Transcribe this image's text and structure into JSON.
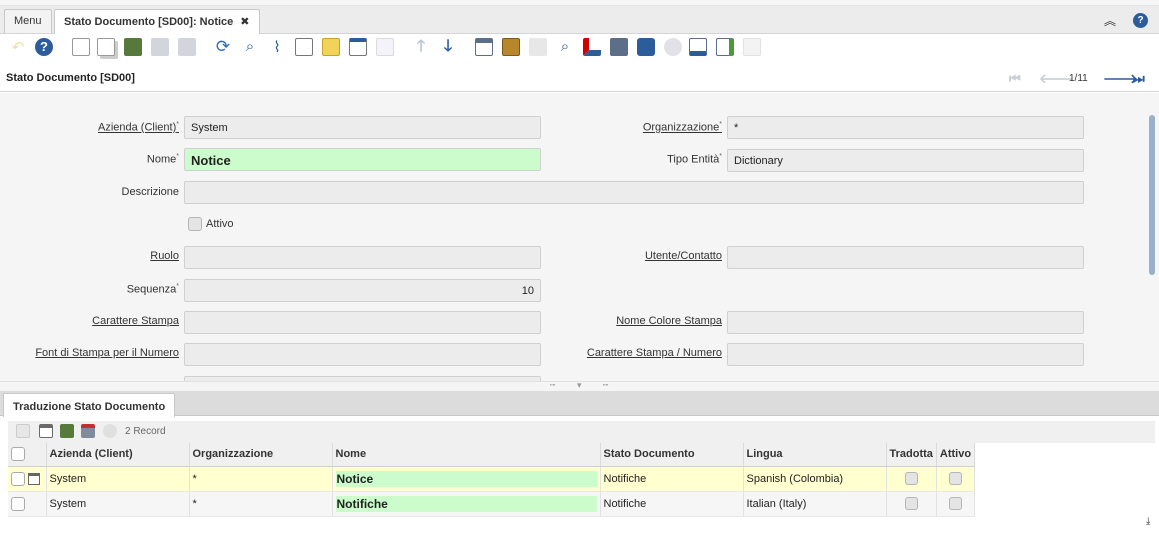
{
  "tabs": [
    {
      "label": "Menu"
    },
    {
      "label": "Stato Documento [SD00]: Notice"
    }
  ],
  "window": {
    "title": "Stato Documento [SD00]",
    "record_position": "1/11"
  },
  "form": {
    "client_label": "Azienda (Client)",
    "client_value": "System",
    "org_label": "Organizzazione",
    "org_value": "*",
    "name_label": "Nome",
    "name_value": "Notice",
    "entity_label": "Tipo Entità",
    "entity_value": "Dictionary",
    "desc_label": "Descrizione",
    "desc_value": "",
    "active_label": "Attivo",
    "role_label": "Ruolo",
    "role_value": "",
    "user_label": "Utente/Contatto",
    "user_value": "",
    "seq_label": "Sequenza",
    "seq_value": "10",
    "print_char_label": "Carattere Stampa",
    "print_char_value": "",
    "print_color_label": "Nome Colore Stampa",
    "print_color_value": "",
    "print_font_label": "Font di Stampa per il Numero",
    "print_font_value": "",
    "print_char_num_label": "Carattere Stampa / Numero",
    "print_char_num_value": ""
  },
  "detail": {
    "tab_label": "Traduzione Stato Documento",
    "record_count": "2 Record",
    "columns": [
      "Azienda (Client)",
      "Organizzazione",
      "Nome",
      "Stato Documento",
      "Lingua",
      "Tradotta",
      "Attivo"
    ],
    "rows": [
      {
        "client": "System",
        "org": "*",
        "name": "Notice",
        "status": "Notifiche",
        "language": "Spanish (Colombia)"
      },
      {
        "client": "System",
        "org": "*",
        "name": "Notifiche",
        "status": "Notifiche",
        "language": "Italian (Italy)"
      }
    ]
  },
  "icons": {
    "toolbar": [
      "undo-icon",
      "help-icon",
      "new-record-icon",
      "copy-record-icon",
      "delete-record-icon",
      "save-icon",
      "save-new-icon",
      "refresh-icon",
      "find-icon",
      "attachment-icon",
      "chat-icon",
      "note-icon",
      "grid-toggle-icon",
      "parent-icon",
      "prev-record-up-icon",
      "next-record-down-icon",
      "report-icon",
      "archive-icon",
      "print-icon",
      "zoom-across-icon",
      "request-icon",
      "product-info-icon",
      "workflow-icon",
      "process-icon",
      "export-icon",
      "import-icon",
      "close-window-icon"
    ]
  }
}
